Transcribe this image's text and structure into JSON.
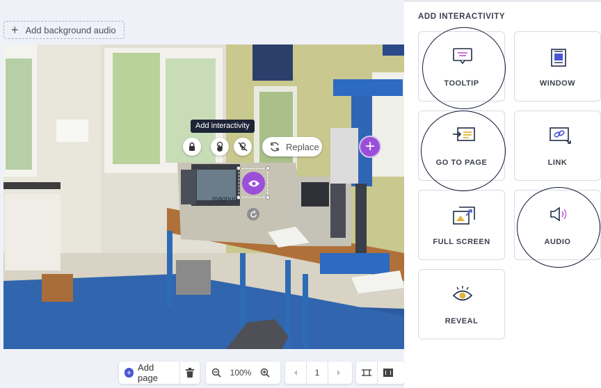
{
  "editor": {
    "add_background_audio": "Add background audio",
    "tooltip_label": "Add interactivity",
    "replace_label": "Replace",
    "scene_sign": "magnum"
  },
  "bottom_bar": {
    "add_page": "Add page",
    "zoom": "100%",
    "page_number": "1"
  },
  "panel": {
    "title": "ADD INTERACTIVITY",
    "options": [
      {
        "label": "TOOLTIP",
        "icon": "tooltip-icon"
      },
      {
        "label": "WINDOW",
        "icon": "window-icon"
      },
      {
        "label": "GO TO PAGE",
        "icon": "go-to-page-icon"
      },
      {
        "label": "LINK",
        "icon": "link-icon"
      },
      {
        "label": "FULL SCREEN",
        "icon": "full-screen-icon"
      },
      {
        "label": "AUDIO",
        "icon": "audio-icon"
      },
      {
        "label": "REVEAL",
        "icon": "reveal-icon"
      }
    ]
  },
  "colors": {
    "accent": "#9b4fd9",
    "primary": "#4a55d6",
    "ring": "#0f1735"
  }
}
